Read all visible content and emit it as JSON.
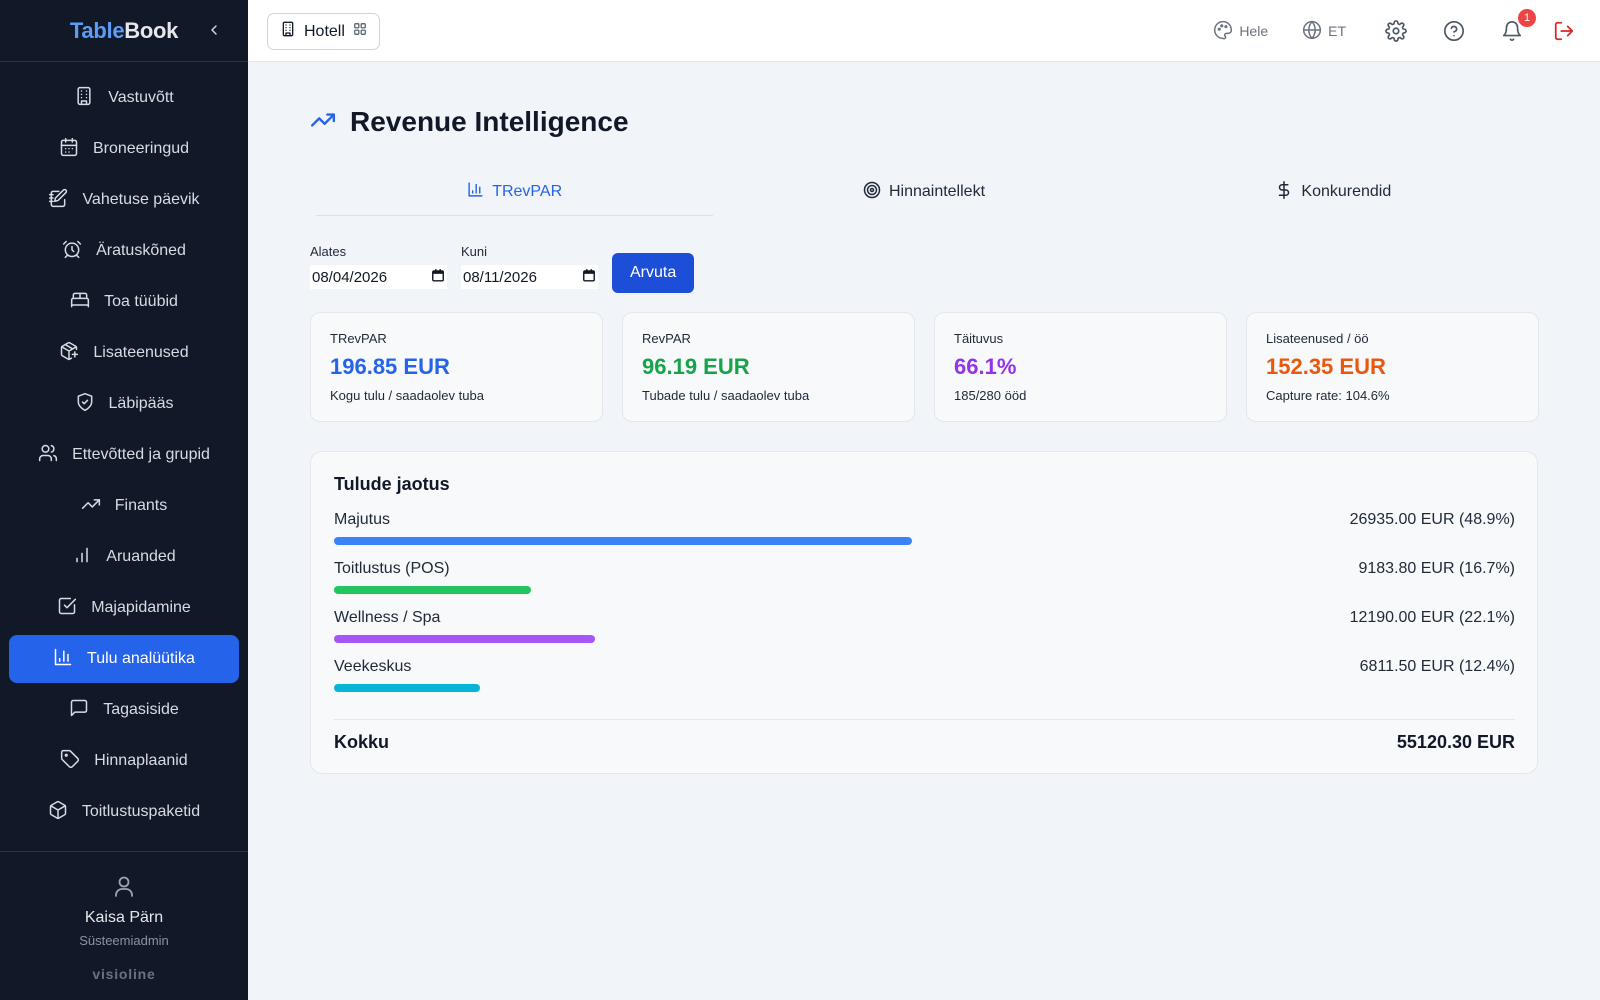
{
  "brand": {
    "part1": "Table",
    "part2": "Book",
    "footer": "visioline"
  },
  "colors": {
    "accent": "#2563eb",
    "sidebar_bg": "#111827",
    "danger": "#ef4444"
  },
  "sidebar": {
    "items": [
      {
        "label": "Vastuvõtt",
        "icon": "building-icon"
      },
      {
        "label": "Broneeringud",
        "icon": "calendar-icon"
      },
      {
        "label": "Vahetuse päevik",
        "icon": "edit-note-icon"
      },
      {
        "label": "Äratuskõned",
        "icon": "alarm-clock-icon"
      },
      {
        "label": "Toa tüübid",
        "icon": "bed-icon"
      },
      {
        "label": "Lisateenused",
        "icon": "package-plus-icon"
      },
      {
        "label": "Läbipääs",
        "icon": "shield-check-icon"
      },
      {
        "label": "Ettevõtted ja grupid",
        "icon": "users-icon"
      },
      {
        "label": "Finants",
        "icon": "trending-up-icon"
      },
      {
        "label": "Aruanded",
        "icon": "bar-chart-icon"
      },
      {
        "label": "Majapidamine",
        "icon": "checkbox-icon"
      },
      {
        "label": "Tulu analüütika",
        "icon": "chart-icon",
        "active": true
      },
      {
        "label": "Tagasiside",
        "icon": "message-icon"
      },
      {
        "label": "Hinnaplaanid",
        "icon": "tag-icon"
      },
      {
        "label": "Toitlustuspaketid",
        "icon": "box-icon"
      }
    ]
  },
  "user": {
    "name": "Kaisa Pärn",
    "role": "Süsteemiadmin"
  },
  "header": {
    "module": "Hotell",
    "theme_label": "Hele",
    "language": "ET",
    "notification_count": "1"
  },
  "page": {
    "title": "Revenue Intelligence"
  },
  "tabs": [
    {
      "label": "TRevPAR",
      "active": true
    },
    {
      "label": "Hinnaintellekt",
      "active": false
    },
    {
      "label": "Konkurendid",
      "active": false
    }
  ],
  "filters": {
    "from_label": "Alates",
    "from_value": "08/04/2026",
    "to_label": "Kuni",
    "to_value": "08/11/2026",
    "calculate": "Arvuta"
  },
  "kpis": [
    {
      "label": "TRevPAR",
      "value": "196.85 EUR",
      "sub": "Kogu tulu / saadaolev tuba",
      "color": "#2563eb"
    },
    {
      "label": "RevPAR",
      "value": "96.19 EUR",
      "sub": "Tubade tulu / saadaolev tuba",
      "color": "#16a34a"
    },
    {
      "label": "Täituvus",
      "value": "66.1%",
      "sub": "185/280 ööd",
      "color": "#9333ea"
    },
    {
      "label": "Lisateenused / öö",
      "value": "152.35 EUR",
      "sub": "Capture rate: 104.6%",
      "color": "#ea580c"
    }
  ],
  "breakdown": {
    "title": "Tulude jaotus",
    "rows": [
      {
        "label": "Majutus",
        "amount": "26935.00 EUR (48.9%)",
        "share": 0.489,
        "color": "#3b82f6"
      },
      {
        "label": "Toitlustus (POS)",
        "amount": "9183.80 EUR (16.7%)",
        "share": 0.167,
        "color": "#22c55e"
      },
      {
        "label": "Wellness / Spa",
        "amount": "12190.00 EUR (22.1%)",
        "share": 0.221,
        "color": "#a855f7"
      },
      {
        "label": "Veekeskus",
        "amount": "6811.50 EUR (12.4%)",
        "share": 0.124,
        "color": "#06b6d4"
      }
    ],
    "total_label": "Kokku",
    "total_value": "55120.30 EUR"
  }
}
